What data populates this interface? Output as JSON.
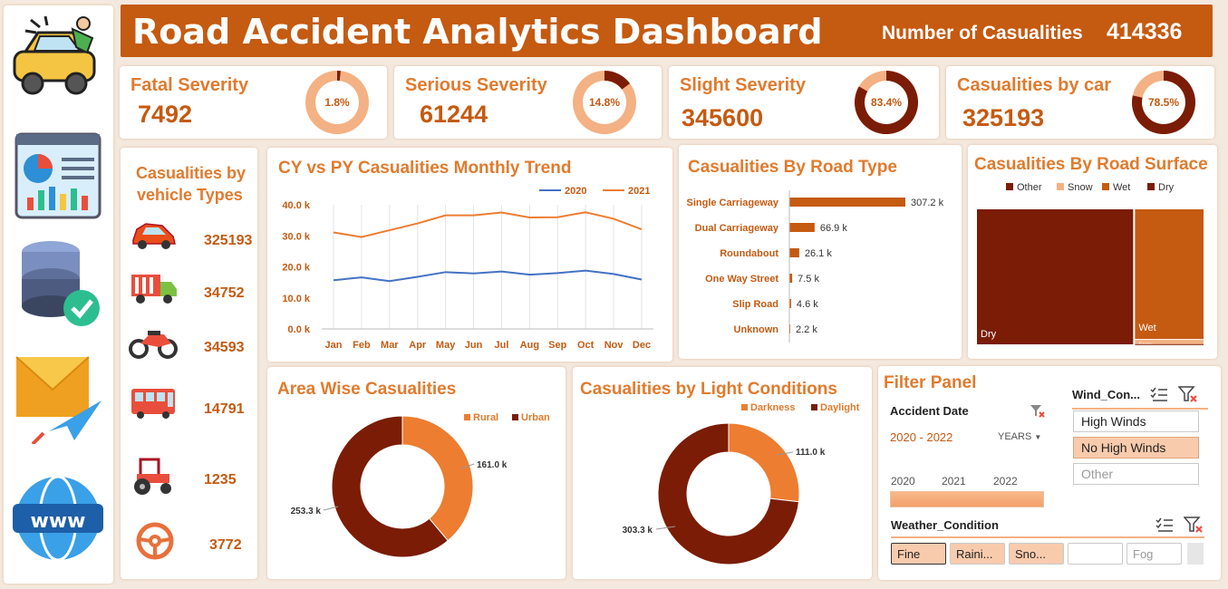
{
  "header": {
    "title": "Road Accident Analytics Dashboard",
    "casualties_label": "Number of Casualities",
    "casualties_value": "414336"
  },
  "sidebar": {
    "icons": [
      "car-accident-icon",
      "dashboard-chart-icon",
      "database-check-icon",
      "email-send-icon",
      "www-globe-icon"
    ]
  },
  "kpis": [
    {
      "title": "Fatal Severity",
      "value": "7492",
      "percent_label": "1.8%",
      "percent": 0.018
    },
    {
      "title": "Serious Severity",
      "value": "61244",
      "percent_label": "14.8%",
      "percent": 0.148
    },
    {
      "title": "Slight Severity",
      "value": "345600",
      "percent_label": "83.4%",
      "percent": 0.834
    },
    {
      "title": "Casualities by car",
      "value": "325193",
      "percent_label": "78.5%",
      "percent": 0.785
    }
  ],
  "vehicles": {
    "title_line1": "Casualities by",
    "title_line2": "vehicle Types",
    "items": [
      {
        "icon": "car-icon",
        "value": "325193"
      },
      {
        "icon": "truck-icon",
        "value": "34752"
      },
      {
        "icon": "motorcycle-icon",
        "value": "34593"
      },
      {
        "icon": "bus-icon",
        "value": "14791"
      },
      {
        "icon": "tractor-icon",
        "value": "1235"
      },
      {
        "icon": "steering-wheel-icon",
        "value": "3772"
      }
    ]
  },
  "trend": {
    "title": "CY vs PY Casualities Monthly Trend"
  },
  "road_type": {
    "title": "Casualities By Road Type"
  },
  "road_surface": {
    "title": "Casualities By Road Surface",
    "legend": [
      "Other",
      "Snow",
      "Wet",
      "Dry"
    ],
    "labels": {
      "dry": "Dry",
      "wet": "Wet",
      "snow": "Snow"
    }
  },
  "area": {
    "title": "Area Wise Casualities"
  },
  "light": {
    "title": "Casualities by Light Conditions"
  },
  "filter": {
    "title": "Filter Panel",
    "accident_date_label": "Accident Date",
    "date_range": "2020 - 2022",
    "period_label": "YEARS",
    "years": [
      "2020",
      "2021",
      "2022"
    ],
    "wind_label": "Wind_Con...",
    "wind_options": [
      "High Winds",
      "No High Winds",
      "Other"
    ],
    "weather_label": "Weather_Condition",
    "weather_options": [
      "Fine",
      "Raini...",
      "Sno...",
      "",
      "Fog"
    ]
  },
  "chart_data": [
    {
      "type": "line",
      "title": "CY vs PY Casualities Monthly Trend",
      "categories": [
        "Jan",
        "Feb",
        "Mar",
        "Apr",
        "May",
        "Jun",
        "Jul",
        "Aug",
        "Sep",
        "Oct",
        "Nov",
        "Dec"
      ],
      "ylim": [
        0,
        40
      ],
      "yticks": [
        "0.0 k",
        "10.0 k",
        "20.0 k",
        "30.0 k",
        "40.0 k"
      ],
      "series": [
        {
          "name": "2020",
          "color": "#4472c4",
          "values": [
            15.7,
            16.6,
            15.4,
            16.8,
            18.3,
            17.9,
            18.5,
            17.5,
            18.0,
            18.8,
            17.7,
            15.9
          ]
        },
        {
          "name": "2021",
          "color": "#ed7d31",
          "values": [
            31.1,
            29.6,
            31.8,
            34.0,
            36.6,
            36.6,
            37.5,
            35.9,
            36.0,
            37.6,
            35.5,
            32.1
          ]
        }
      ]
    },
    {
      "type": "bar",
      "title": "Casualities By Road Type",
      "categories": [
        "Single Carriageway",
        "Dual Carriageway",
        "Roundabout",
        "One Way Street",
        "Slip Road",
        "Unknown"
      ],
      "values": [
        307.2,
        66.9,
        26.1,
        7.5,
        4.6,
        2.2
      ],
      "value_labels": [
        "307.2 k",
        "66.9 k",
        "26.1 k",
        "7.5 k",
        "4.6 k",
        "2.2 k"
      ],
      "color": "#c55a11"
    },
    {
      "type": "heatmap",
      "title": "Casualities By Road Surface",
      "categories": [
        "Other",
        "Snow",
        "Wet",
        "Dry"
      ],
      "values": [
        1.0,
        3.0,
        117.0,
        279.0
      ],
      "colors": [
        "#7b1c06",
        "#f4b183",
        "#c55a11",
        "#7b1c06"
      ]
    },
    {
      "type": "pie",
      "title": "Area Wise Casualities",
      "categories": [
        "Rural",
        "Urban"
      ],
      "values": [
        161.0,
        253.3
      ],
      "value_labels": [
        "161.0 k",
        "253.3 k"
      ],
      "colors": [
        "#ed7d31",
        "#7b1c06"
      ]
    },
    {
      "type": "pie",
      "title": "Casualities by Light Conditions",
      "categories": [
        "Darkness",
        "Daylight"
      ],
      "values": [
        111.0,
        303.3
      ],
      "value_labels": [
        "111.0 k",
        "303.3 k"
      ],
      "colors": [
        "#ed7d31",
        "#7b1c06"
      ]
    }
  ]
}
